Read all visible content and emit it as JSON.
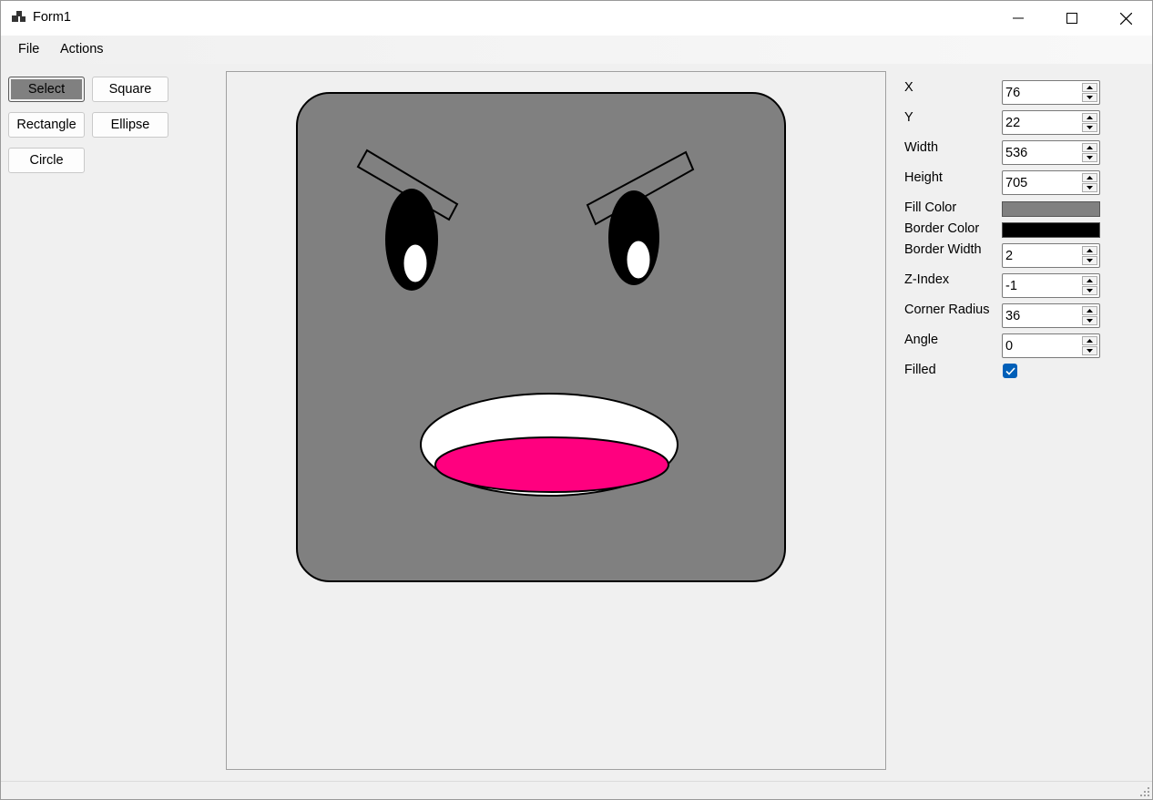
{
  "window": {
    "title": "Form1"
  },
  "menu": {
    "file": "File",
    "actions": "Actions"
  },
  "tools": {
    "select": "Select",
    "square": "Square",
    "rectangle": "Rectangle",
    "ellipse": "Ellipse",
    "circle": "Circle",
    "selected": "select"
  },
  "properties": {
    "x": {
      "label": "X",
      "value": "76"
    },
    "y": {
      "label": "Y",
      "value": "22"
    },
    "width": {
      "label": "Width",
      "value": "536"
    },
    "height": {
      "label": "Height",
      "value": "705"
    },
    "fill_color": {
      "label": "Fill Color",
      "color": "#808080"
    },
    "border_color": {
      "label": "Border Color",
      "color": "#000000"
    },
    "border_width": {
      "label": "Border Width",
      "value": "2"
    },
    "z_index": {
      "label": "Z-Index",
      "value": "-1"
    },
    "corner_radius": {
      "label": "Corner Radius",
      "value": "36"
    },
    "angle": {
      "label": "Angle",
      "value": "0"
    },
    "filled": {
      "label": "Filled",
      "checked": true
    }
  },
  "colors": {
    "face": "#808080",
    "mouth_outer": "#ffffff",
    "mouth_inner": "#ff007f",
    "checkbox_accent": "#005fb8"
  }
}
